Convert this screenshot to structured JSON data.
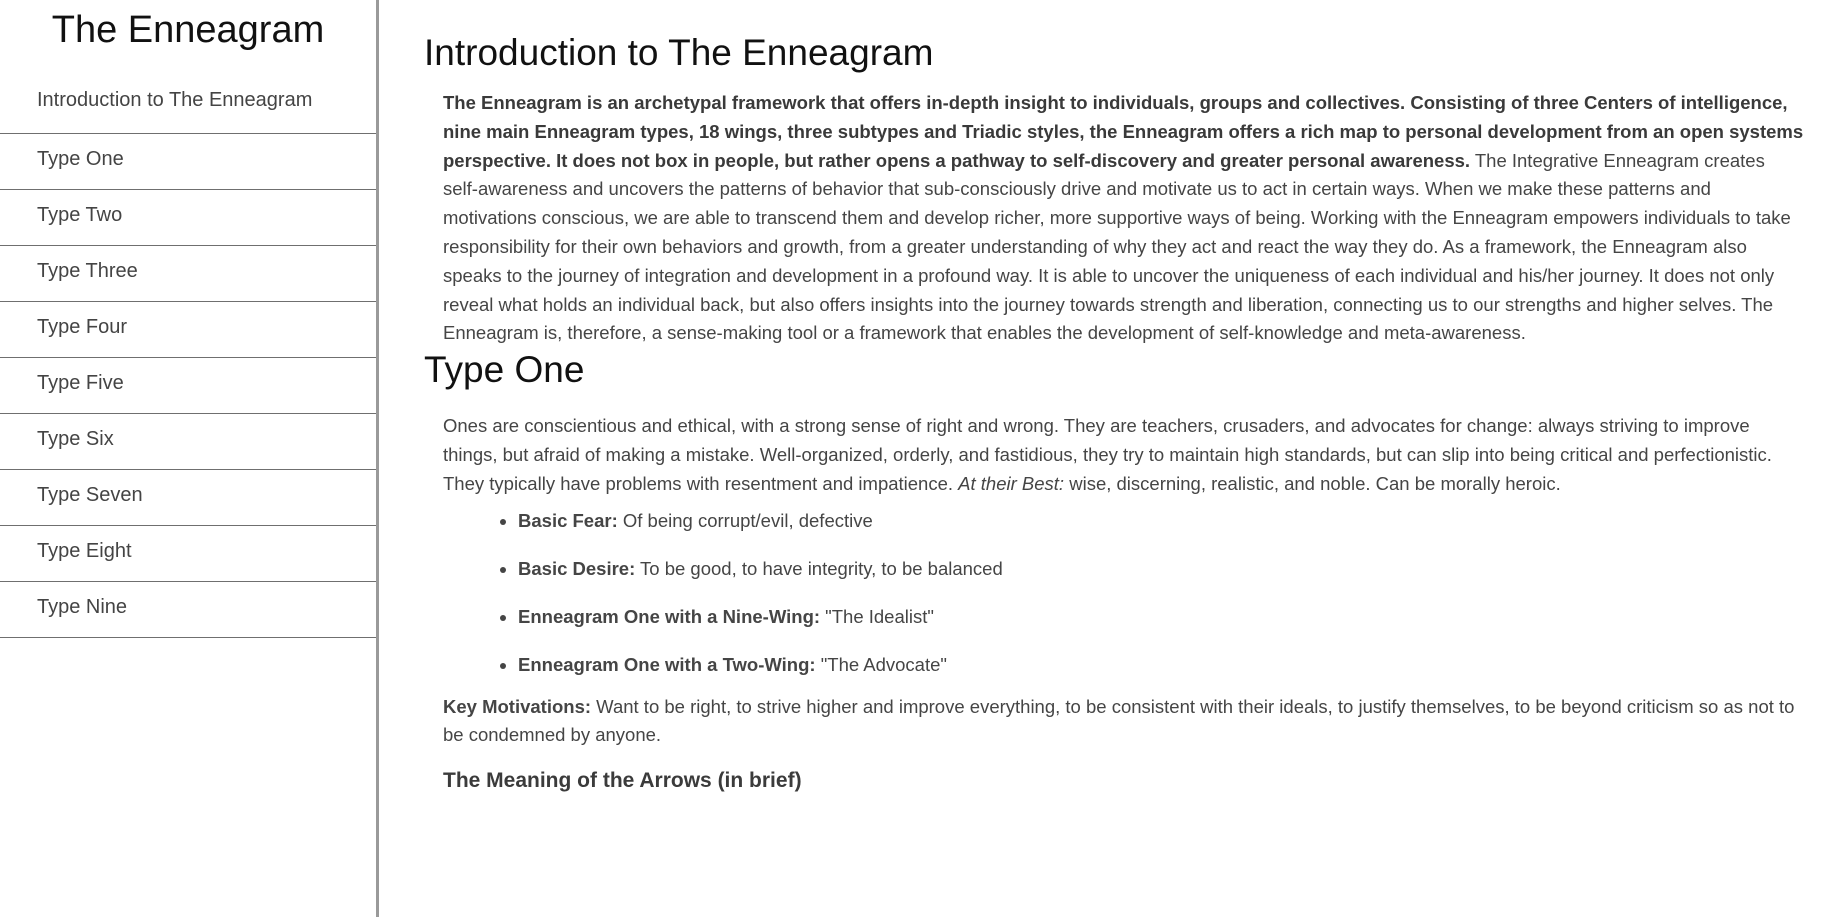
{
  "sidebar": {
    "title": "The Enneagram",
    "items": [
      {
        "label": "Introduction to The Enneagram"
      },
      {
        "label": "Type One"
      },
      {
        "label": "Type Two"
      },
      {
        "label": "Type Three"
      },
      {
        "label": "Type Four"
      },
      {
        "label": "Type Five"
      },
      {
        "label": "Type Six"
      },
      {
        "label": "Type Seven"
      },
      {
        "label": "Type Eight"
      },
      {
        "label": "Type Nine"
      }
    ]
  },
  "intro": {
    "title": "Introduction to The Enneagram",
    "bold_text": "The Enneagram is an archetypal framework that offers in-depth insight to individuals, groups and collectives. Consisting of three Centers of intelligence, nine main Enneagram types, 18 wings, three subtypes and Triadic styles, the Enneagram offers a rich map to personal development from an open systems perspective. It does not box in people, but rather opens a pathway to self-discovery and greater personal awareness.",
    "regular_text": " The Integrative Enneagram creates self-awareness and uncovers the patterns of behavior that sub-consciously drive and motivate us to act in certain ways. When we make these patterns and motivations conscious, we are able to transcend them and develop richer, more supportive ways of being. Working with the Enneagram empowers individuals to take responsibility for their own behaviors and growth, from a greater understanding of why they act and react the way they do. As a framework, the Enneagram also speaks to the journey of integration and development in a profound way. It is able to uncover the uniqueness of each individual and his/her journey. It does not only reveal what holds an individual back, but also offers insights into the journey towards strength and liberation, connecting us to our strengths and higher selves. The Enneagram is, therefore, a sense-making tool or a framework that enables the development of self-knowledge and meta-awareness."
  },
  "type_one": {
    "title": "Type One",
    "description": "Ones are conscientious and ethical, with a strong sense of right and wrong. They are teachers, crusaders, and advocates for change: always striving to improve things, but afraid of making a mistake. Well-organized, orderly, and fastidious, they try to maintain high standards, but can slip into being critical and perfectionistic. They typically have problems with resentment and impatience. ",
    "best_label": "At their Best:",
    "best_text": " wise, discerning, realistic, and noble. Can be morally heroic.",
    "facts": [
      {
        "label": "Basic Fear:",
        "text": " Of being corrupt/evil, defective"
      },
      {
        "label": "Basic Desire:",
        "text": " To be good, to have integrity, to be balanced"
      },
      {
        "label": "Enneagram One with a Nine-Wing:",
        "text": " \"The Idealist\""
      },
      {
        "label": "Enneagram One with a Two-Wing:",
        "text": " \"The Advocate\""
      }
    ],
    "motivations_label": "Key Motivations:",
    "motivations_text": " Want to be right, to strive higher and improve everything, to be consistent with their ideals, to justify themselves, to be beyond criticism so as not to be condemned by anyone.",
    "arrows_heading": "The Meaning of the Arrows (in brief)"
  }
}
